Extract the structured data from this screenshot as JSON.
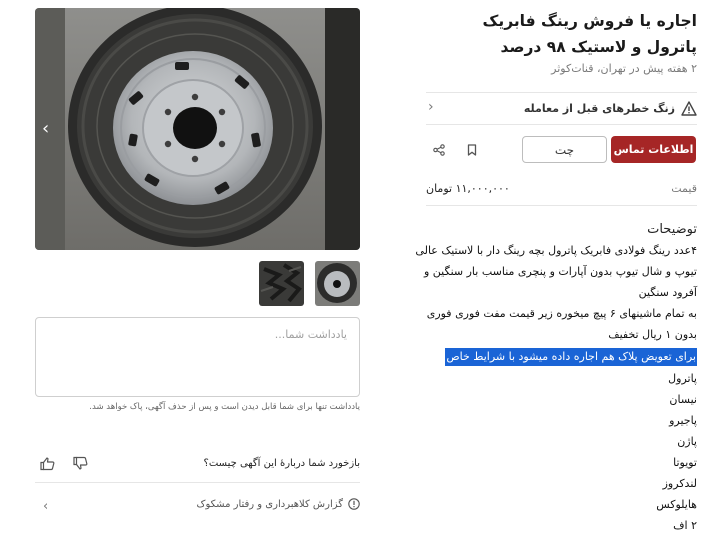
{
  "ad": {
    "title": "اجاره یا فروش رینگ فابریک پاترول و لاستیک ۹۸ درصد",
    "posted": "۲ هفته پیش در تهران، قنات‌کوثر"
  },
  "warning": {
    "text": "زنگ خطرهای قبل از معامله"
  },
  "actions": {
    "contact_label": "اطلاعات تماس",
    "chat_label": "چت"
  },
  "price": {
    "label": "قیمت",
    "value": "۱۱,۰۰۰,۰۰۰ تومان"
  },
  "description": {
    "title": "توضیحات",
    "lines": [
      "۴عدد رینگ فولادی فابریک پاترول بچه رینگ دار با لاستیک عالی",
      "تیوپ و شال تیوپ بدون آپارات و پنچری مناسب بار سنگین و",
      "آفرود سنگین",
      "به تمام ماشینهای ۶ پیچ میخوره زیر قیمت مفت فوری فوری",
      "بدون ۱ ریال تخفیف",
      "برای تعویض پلاک هم اجاره داده میشود با شرایط خاص",
      "پاترول",
      "نیسان",
      "پاجیرو",
      "پاژن",
      "تویوتا",
      "لندکروز",
      "هایلوکس",
      "۲ اف"
    ]
  },
  "notes": {
    "placeholder": "یادداشت شما...",
    "hint": "یادداشت تنها برای شما قابل دیدن است و پس از حذف آگهی، پاک خواهد شد."
  },
  "feedback": {
    "question": "بازخورد شما دربارهٔ این آگهی چیست؟"
  },
  "report": {
    "label": "گزارش کلاهبرداری و رفتار مشکوک"
  },
  "colors": {
    "primary": "#a62626",
    "highlight": "#1a64d6"
  }
}
